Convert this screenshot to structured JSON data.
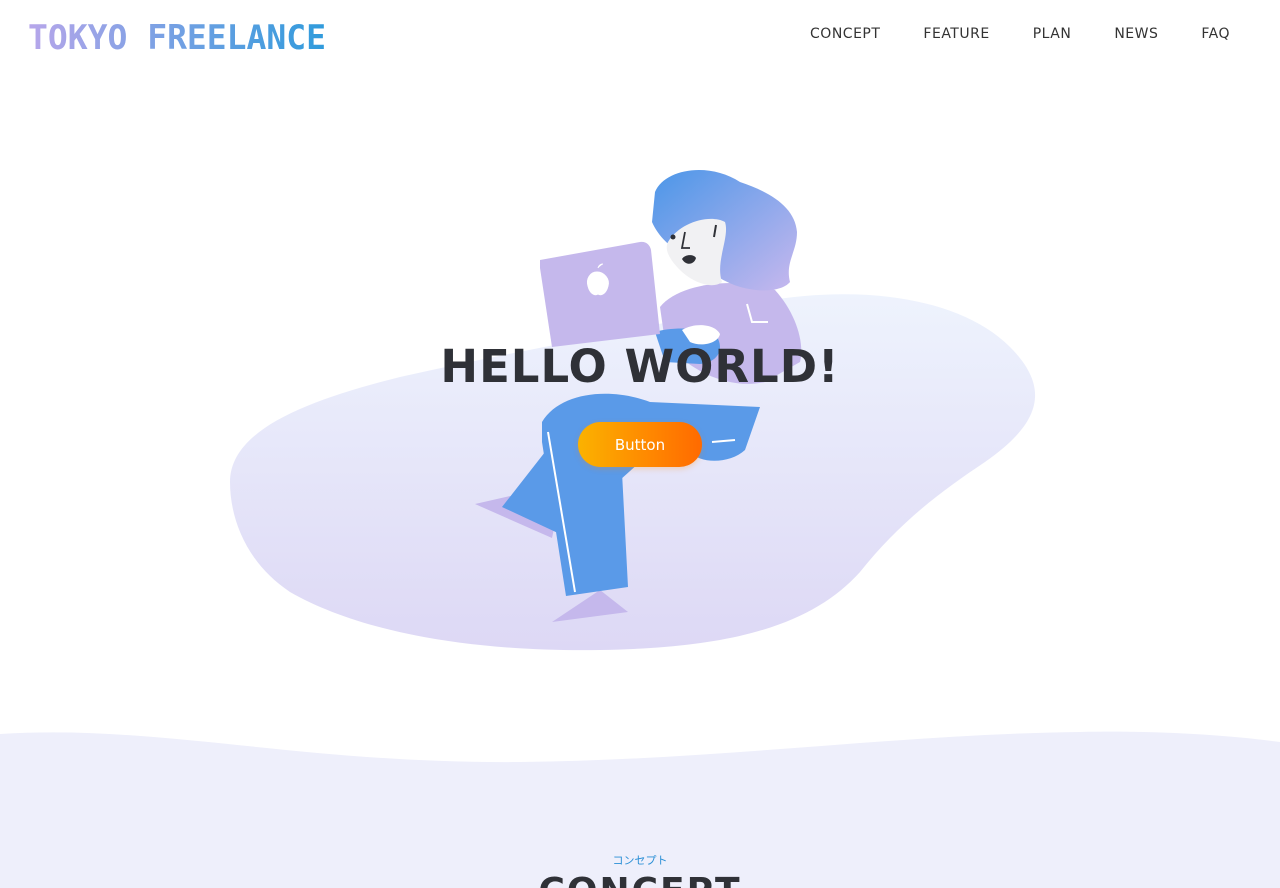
{
  "brand": {
    "logo_text": "TOKYO FREELANCE",
    "gradient_start": "#b7a6ea",
    "gradient_end": "#2f9bdc"
  },
  "nav": {
    "items": [
      {
        "label": "CONCEPT"
      },
      {
        "label": "FEATURE"
      },
      {
        "label": "PLAN"
      },
      {
        "label": "NEWS"
      },
      {
        "label": "FAQ"
      }
    ]
  },
  "hero": {
    "title": "HELLO WORLD!",
    "button_label": "Button",
    "illustration": "woman-with-laptop-illustration",
    "colors": {
      "blob_top": "#eef2fd",
      "blob_bottom": "#dcd7f4",
      "figure_blue": "#5a9ae8",
      "figure_lavender": "#c4b8ec",
      "button_start": "#fbb200",
      "button_end": "#ff6a00"
    }
  },
  "concept": {
    "subtitle": "コンセプト",
    "title": "CONCEPT",
    "background": "#eeeffb"
  }
}
